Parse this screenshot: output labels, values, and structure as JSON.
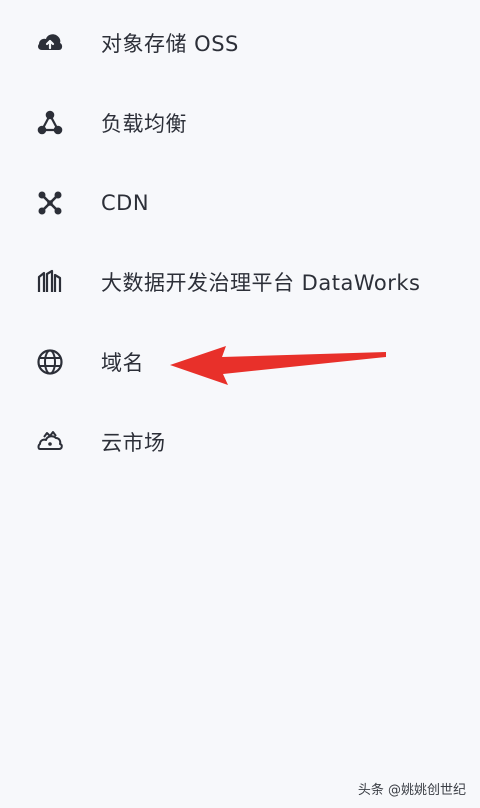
{
  "menu": {
    "items": [
      {
        "label": "对象存储 OSS",
        "icon": "cloud-upload-icon"
      },
      {
        "label": "负载均衡",
        "icon": "load-balancer-icon"
      },
      {
        "label": "CDN",
        "icon": "cdn-network-icon"
      },
      {
        "label": "大数据开发治理平台 DataWorks",
        "icon": "dataworks-icon"
      },
      {
        "label": "域名",
        "icon": "globe-icon"
      },
      {
        "label": "云市场",
        "icon": "cloud-market-icon"
      }
    ]
  },
  "annotation": {
    "arrow_color": "#e8302a"
  },
  "watermark": {
    "text": "头条 @姚姚创世纪"
  },
  "colors": {
    "background": "#f7f8fb",
    "text": "#2c2f38",
    "icon": "#2c2f38"
  }
}
